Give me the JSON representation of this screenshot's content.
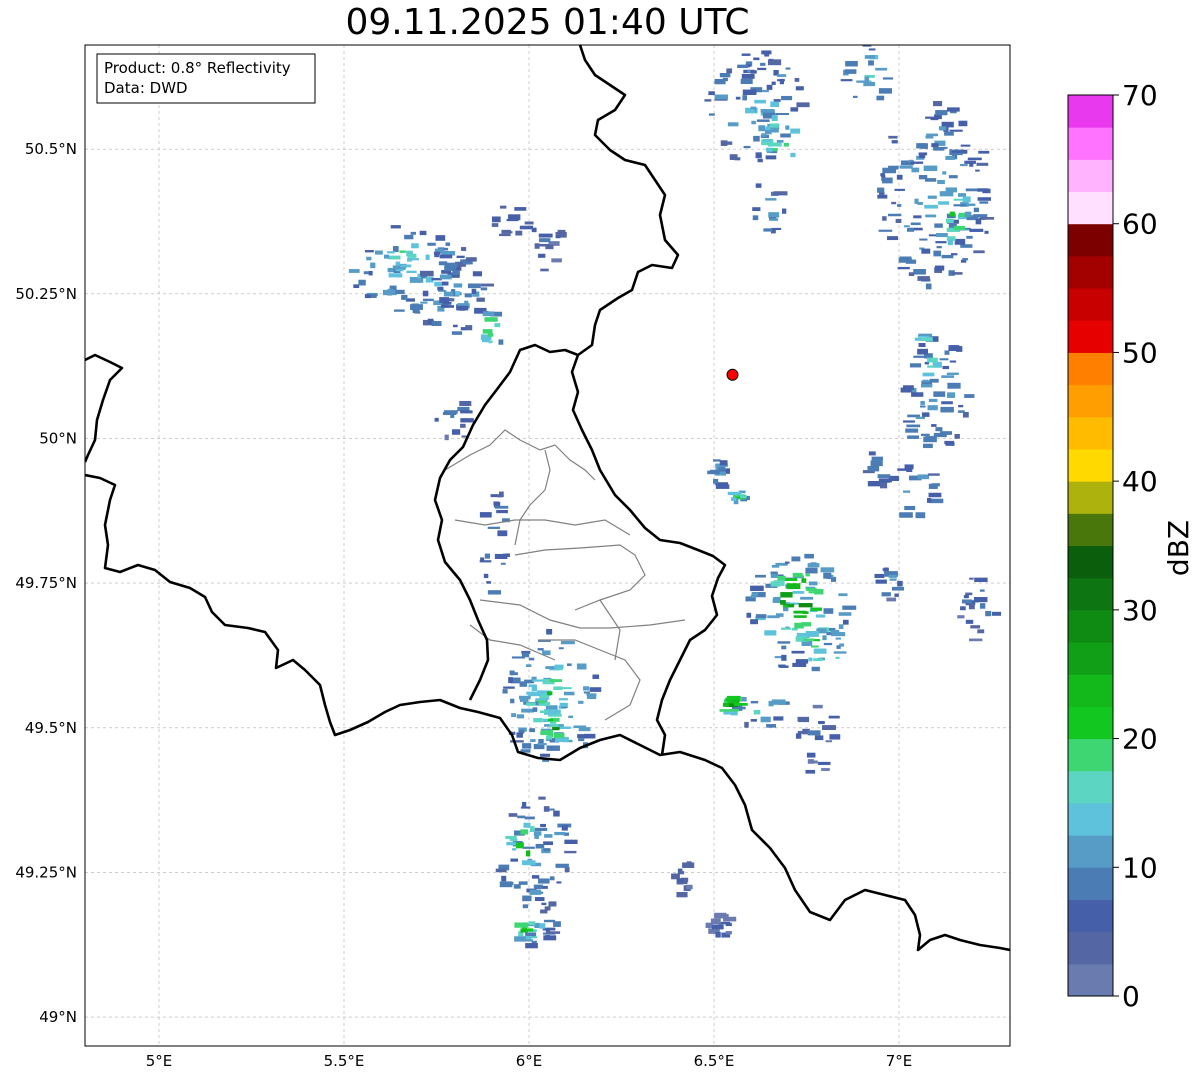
{
  "title": "09.11.2025 01:40 UTC",
  "info": {
    "product": "Product: 0.8° Reflectivity",
    "source": "Data: DWD"
  },
  "map": {
    "lon_range": [
      4.8,
      7.3
    ],
    "lat_range": [
      48.95,
      50.68
    ],
    "lon_ticks": [
      {
        "value": 5.0,
        "label": "5°E"
      },
      {
        "value": 5.5,
        "label": "5.5°E"
      },
      {
        "value": 6.0,
        "label": "6°E"
      },
      {
        "value": 6.5,
        "label": "6.5°E"
      },
      {
        "value": 7.0,
        "label": "7°E"
      }
    ],
    "lat_ticks": [
      {
        "value": 49.0,
        "label": "49°N"
      },
      {
        "value": 49.25,
        "label": "49.25°N"
      },
      {
        "value": 49.5,
        "label": "49.5°N"
      },
      {
        "value": 49.75,
        "label": "49.75°N"
      },
      {
        "value": 50.0,
        "label": "50°N"
      },
      {
        "value": 50.25,
        "label": "50.25°N"
      },
      {
        "value": 50.5,
        "label": "50.5°N"
      }
    ],
    "radar_site": {
      "lon": 6.55,
      "lat": 50.11,
      "color": "#ff0000"
    },
    "echo_cells": [
      {
        "lon": 5.68,
        "lat": 50.29,
        "rlon": 0.16,
        "rlat": 0.08,
        "dbz": 14
      },
      {
        "lon": 5.66,
        "lat": 50.32,
        "rlon": 0.05,
        "rlat": 0.025,
        "dbz": 22
      },
      {
        "lon": 5.8,
        "lat": 50.25,
        "rlon": 0.1,
        "rlat": 0.08,
        "dbz": 10
      },
      {
        "lon": 5.9,
        "lat": 50.19,
        "rlon": 0.04,
        "rlat": 0.03,
        "dbz": 22
      },
      {
        "lon": 5.95,
        "lat": 50.38,
        "rlon": 0.06,
        "rlat": 0.03,
        "dbz": 8
      },
      {
        "lon": 6.05,
        "lat": 50.33,
        "rlon": 0.06,
        "rlat": 0.04,
        "dbz": 6
      },
      {
        "lon": 5.8,
        "lat": 50.03,
        "rlon": 0.05,
        "rlat": 0.04,
        "dbz": 8
      },
      {
        "lon": 6.62,
        "lat": 50.57,
        "rlon": 0.14,
        "rlat": 0.1,
        "dbz": 12
      },
      {
        "lon": 6.68,
        "lat": 50.52,
        "rlon": 0.06,
        "rlat": 0.04,
        "dbz": 22
      },
      {
        "lon": 6.65,
        "lat": 50.4,
        "rlon": 0.04,
        "rlat": 0.06,
        "dbz": 12
      },
      {
        "lon": 6.92,
        "lat": 50.63,
        "rlon": 0.07,
        "rlat": 0.05,
        "dbz": 14
      },
      {
        "lon": 7.1,
        "lat": 50.42,
        "rlon": 0.15,
        "rlat": 0.16,
        "dbz": 12
      },
      {
        "lon": 7.15,
        "lat": 50.38,
        "rlon": 0.05,
        "rlat": 0.06,
        "dbz": 20
      },
      {
        "lon": 7.1,
        "lat": 50.08,
        "rlon": 0.1,
        "rlat": 0.1,
        "dbz": 12
      },
      {
        "lon": 7.08,
        "lat": 50.14,
        "rlon": 0.03,
        "rlat": 0.05,
        "dbz": 22
      },
      {
        "lon": 6.95,
        "lat": 49.95,
        "rlon": 0.05,
        "rlat": 0.04,
        "dbz": 10
      },
      {
        "lon": 7.05,
        "lat": 49.91,
        "rlon": 0.06,
        "rlat": 0.05,
        "dbz": 12
      },
      {
        "lon": 6.98,
        "lat": 49.75,
        "rlon": 0.04,
        "rlat": 0.03,
        "dbz": 10
      },
      {
        "lon": 7.22,
        "lat": 49.71,
        "rlon": 0.06,
        "rlat": 0.06,
        "dbz": 8
      },
      {
        "lon": 6.73,
        "lat": 49.7,
        "rlon": 0.14,
        "rlat": 0.1,
        "dbz": 16
      },
      {
        "lon": 6.72,
        "lat": 49.72,
        "rlon": 0.07,
        "rlat": 0.06,
        "dbz": 32
      },
      {
        "lon": 6.79,
        "lat": 49.64,
        "rlon": 0.07,
        "rlat": 0.04,
        "dbz": 22
      },
      {
        "lon": 6.62,
        "lat": 49.53,
        "rlon": 0.08,
        "rlat": 0.03,
        "dbz": 14
      },
      {
        "lon": 6.55,
        "lat": 49.54,
        "rlon": 0.03,
        "rlat": 0.015,
        "dbz": 30
      },
      {
        "lon": 6.78,
        "lat": 49.48,
        "rlon": 0.06,
        "rlat": 0.06,
        "dbz": 6
      },
      {
        "lon": 6.51,
        "lat": 49.94,
        "rlon": 0.025,
        "rlat": 0.03,
        "dbz": 12
      },
      {
        "lon": 6.57,
        "lat": 49.9,
        "rlon": 0.02,
        "rlat": 0.01,
        "dbz": 22
      },
      {
        "lon": 5.91,
        "lat": 49.82,
        "rlon": 0.04,
        "rlat": 0.1,
        "dbz": 10
      },
      {
        "lon": 6.06,
        "lat": 49.55,
        "rlon": 0.13,
        "rlat": 0.12,
        "dbz": 14
      },
      {
        "lon": 6.06,
        "lat": 49.55,
        "rlon": 0.06,
        "rlat": 0.06,
        "dbz": 24
      },
      {
        "lon": 6.07,
        "lat": 49.5,
        "rlon": 0.03,
        "rlat": 0.03,
        "dbz": 28
      },
      {
        "lon": 6.02,
        "lat": 49.28,
        "rlon": 0.1,
        "rlat": 0.1,
        "dbz": 12
      },
      {
        "lon": 5.99,
        "lat": 49.3,
        "rlon": 0.04,
        "rlat": 0.04,
        "dbz": 26
      },
      {
        "lon": 6.02,
        "lat": 49.16,
        "rlon": 0.06,
        "rlat": 0.04,
        "dbz": 12
      },
      {
        "lon": 5.99,
        "lat": 49.15,
        "rlon": 0.025,
        "rlat": 0.02,
        "dbz": 24
      },
      {
        "lon": 6.42,
        "lat": 49.24,
        "rlon": 0.03,
        "rlat": 0.03,
        "dbz": 6
      },
      {
        "lon": 6.52,
        "lat": 49.16,
        "rlon": 0.04,
        "rlat": 0.02,
        "dbz": 6
      }
    ]
  },
  "colorbar": {
    "label": "dBZ",
    "range": [
      0,
      70
    ],
    "tick_values": [
      0,
      10,
      20,
      30,
      40,
      50,
      60,
      70
    ],
    "tick_labels": [
      "0",
      "10",
      "20",
      "30",
      "40",
      "50",
      "60",
      "70"
    ],
    "bins": [
      {
        "from": 0,
        "to": 2.5,
        "color": "#6a7bb0"
      },
      {
        "from": 2.5,
        "to": 5,
        "color": "#5466a3"
      },
      {
        "from": 5,
        "to": 7.5,
        "color": "#4560a8"
      },
      {
        "from": 7.5,
        "to": 10,
        "color": "#4b7cb4"
      },
      {
        "from": 10,
        "to": 12.5,
        "color": "#569cc7"
      },
      {
        "from": 12.5,
        "to": 15,
        "color": "#5fc2dc"
      },
      {
        "from": 15,
        "to": 17.5,
        "color": "#5cd6c2"
      },
      {
        "from": 17.5,
        "to": 20,
        "color": "#3ed672"
      },
      {
        "from": 20,
        "to": 22.5,
        "color": "#12c71f"
      },
      {
        "from": 22.5,
        "to": 25,
        "color": "#13b81b"
      },
      {
        "from": 25,
        "to": 27.5,
        "color": "#109f16"
      },
      {
        "from": 27.5,
        "to": 30,
        "color": "#0f8a13"
      },
      {
        "from": 30,
        "to": 32.5,
        "color": "#0d7511"
      },
      {
        "from": 32.5,
        "to": 35,
        "color": "#0a5e0c"
      },
      {
        "from": 35,
        "to": 37.5,
        "color": "#4a770c"
      },
      {
        "from": 37.5,
        "to": 40,
        "color": "#adb30c"
      },
      {
        "from": 40,
        "to": 42.5,
        "color": "#ffd900"
      },
      {
        "from": 42.5,
        "to": 45,
        "color": "#ffbb00"
      },
      {
        "from": 45,
        "to": 47.5,
        "color": "#ff9e00"
      },
      {
        "from": 47.5,
        "to": 50,
        "color": "#ff7f00"
      },
      {
        "from": 50,
        "to": 52.5,
        "color": "#e60000"
      },
      {
        "from": 52.5,
        "to": 55,
        "color": "#c80000"
      },
      {
        "from": 55,
        "to": 57.5,
        "color": "#a30000"
      },
      {
        "from": 57.5,
        "to": 60,
        "color": "#7d0000"
      },
      {
        "from": 60,
        "to": 62.5,
        "color": "#ffe0ff"
      },
      {
        "from": 62.5,
        "to": 65,
        "color": "#ffb3ff"
      },
      {
        "from": 65,
        "to": 67.5,
        "color": "#ff73ff"
      },
      {
        "from": 67.5,
        "to": 70,
        "color": "#e939ef"
      }
    ]
  }
}
